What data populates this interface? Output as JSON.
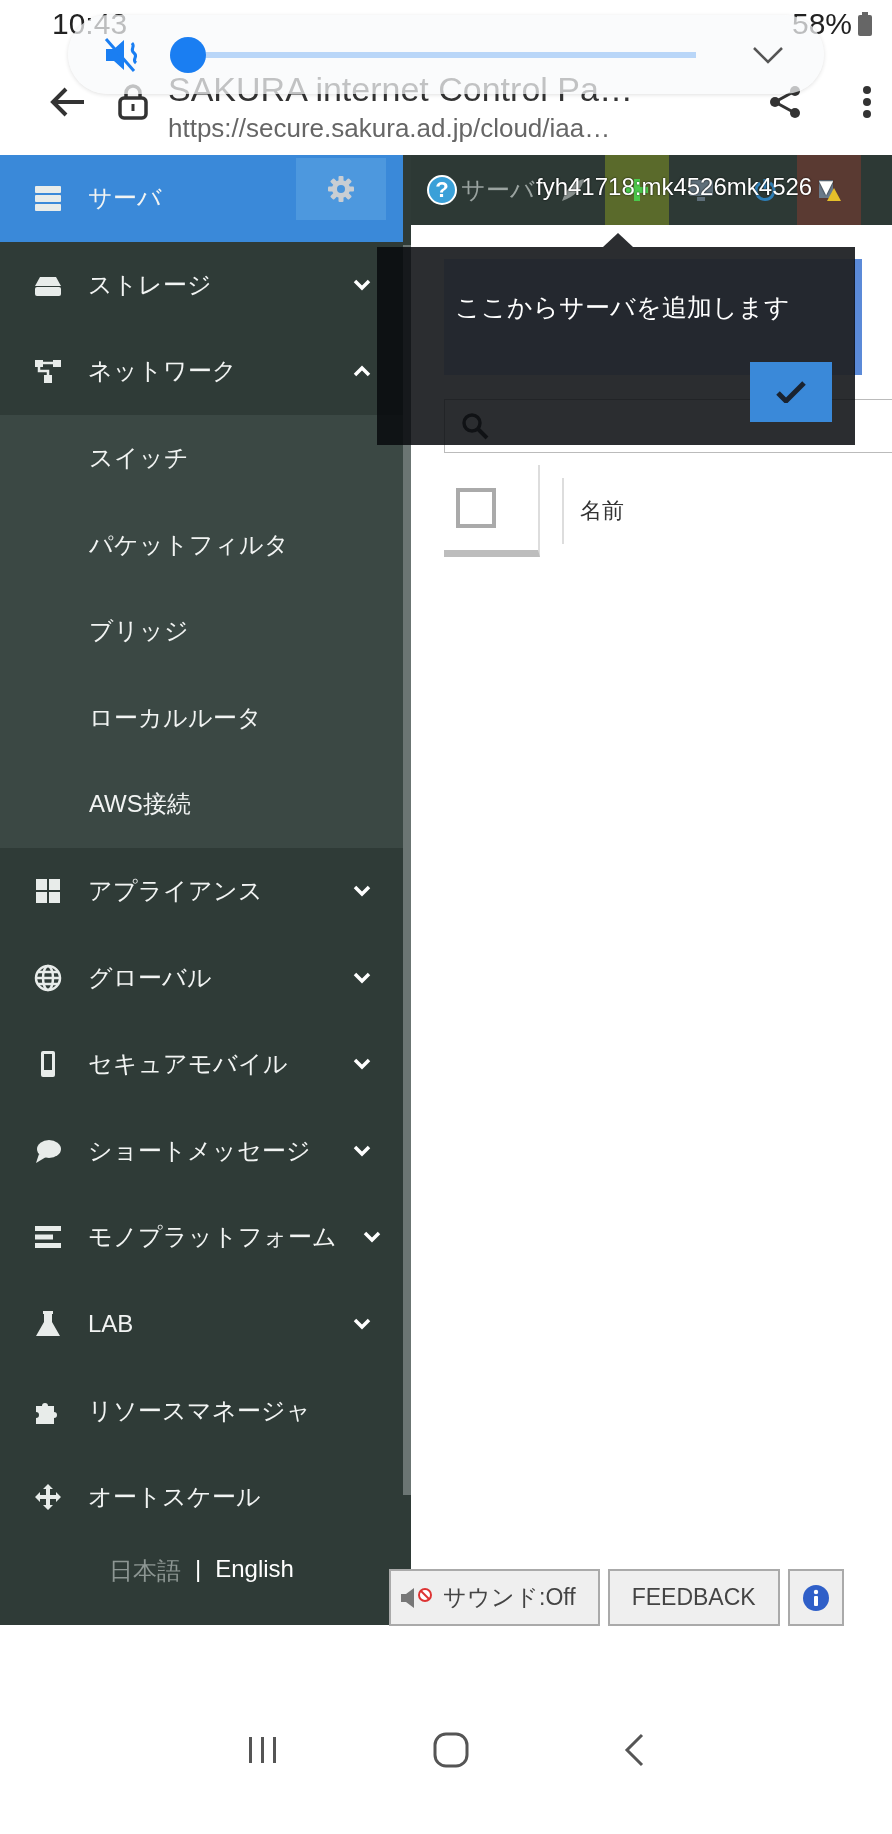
{
  "status_bar": {
    "time": "10:43",
    "battery": "58%"
  },
  "volume_panel": {
    "muted": true,
    "level": 0.0
  },
  "browser": {
    "title": "SAKURA internet Control Pa…",
    "url": "https://secure.sakura.ad.jp/cloud/iaa…"
  },
  "sidebar": {
    "items": [
      {
        "label": "サーバ",
        "kind": "link",
        "selected": true
      },
      {
        "label": "ストレージ",
        "kind": "group",
        "selected": false,
        "expanded": false
      },
      {
        "label": "ネットワーク",
        "kind": "group",
        "selected": false,
        "expanded": true,
        "children": [
          {
            "label": "スイッチ",
            "selected": false
          },
          {
            "label": "パケットフィルタ",
            "selected": false
          },
          {
            "label": "ブリッジ",
            "selected": false
          },
          {
            "label": "ローカルルータ",
            "selected": false
          },
          {
            "label": "AWS接続",
            "selected": false
          }
        ]
      },
      {
        "label": "アプライアンス",
        "kind": "group",
        "selected": false,
        "expanded": false
      },
      {
        "label": "グローバル",
        "kind": "group",
        "selected": false,
        "expanded": false
      },
      {
        "label": "セキュアモバイル",
        "kind": "group",
        "selected": false,
        "expanded": false
      },
      {
        "label": "ショートメッセージ",
        "kind": "group",
        "selected": false,
        "expanded": false
      },
      {
        "label": "モノプラットフォーム",
        "kind": "group",
        "selected": false,
        "expanded": false
      },
      {
        "label": "LAB",
        "kind": "group",
        "selected": false,
        "expanded": false
      },
      {
        "label": "リソースマネージャ",
        "kind": "link",
        "selected": false
      },
      {
        "label": "オートスケール",
        "kind": "link",
        "selected": false
      }
    ],
    "languages": [
      {
        "label": "日本語",
        "selected": true
      },
      {
        "label": "English",
        "selected": false
      }
    ],
    "language_separator": "|"
  },
  "header": {
    "help": "?",
    "title": "サーバ",
    "user": "fyh41718:mk4526mk4526",
    "user_caret": "▼"
  },
  "table": {
    "columns": [
      "名前"
    ],
    "select_all_checked": false
  },
  "tooltip": {
    "text": "ここからサーバを追加します"
  },
  "footer_buttons": [
    {
      "kind": "sound",
      "label": "サウンド:Off"
    },
    {
      "kind": "text",
      "label": "FEEDBACK"
    },
    {
      "kind": "info"
    }
  ]
}
